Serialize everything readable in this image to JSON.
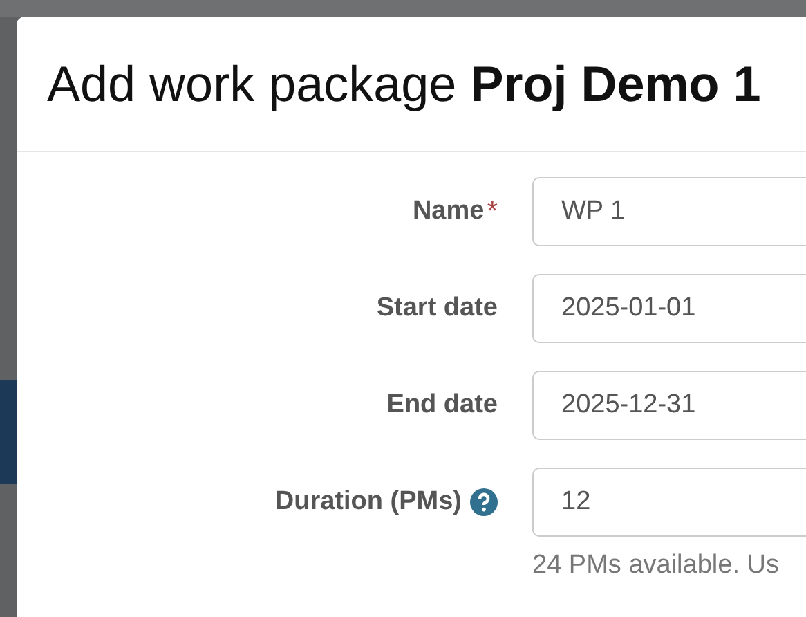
{
  "modal": {
    "title": "Add work package **Proj Demo 1**",
    "fields": [
      {
        "label": "Name",
        "required_mark": "*",
        "help": false,
        "value": "WP 1"
      },
      {
        "label": "Start date",
        "help": false,
        "value": "2025-01-01"
      },
      {
        "label": "End date",
        "help": false,
        "value": "2025-12-31"
      },
      {
        "label": "Duration (PMs)",
        "help": true,
        "value": "12",
        "note": "24 PMs available. Us"
      }
    ]
  }
}
